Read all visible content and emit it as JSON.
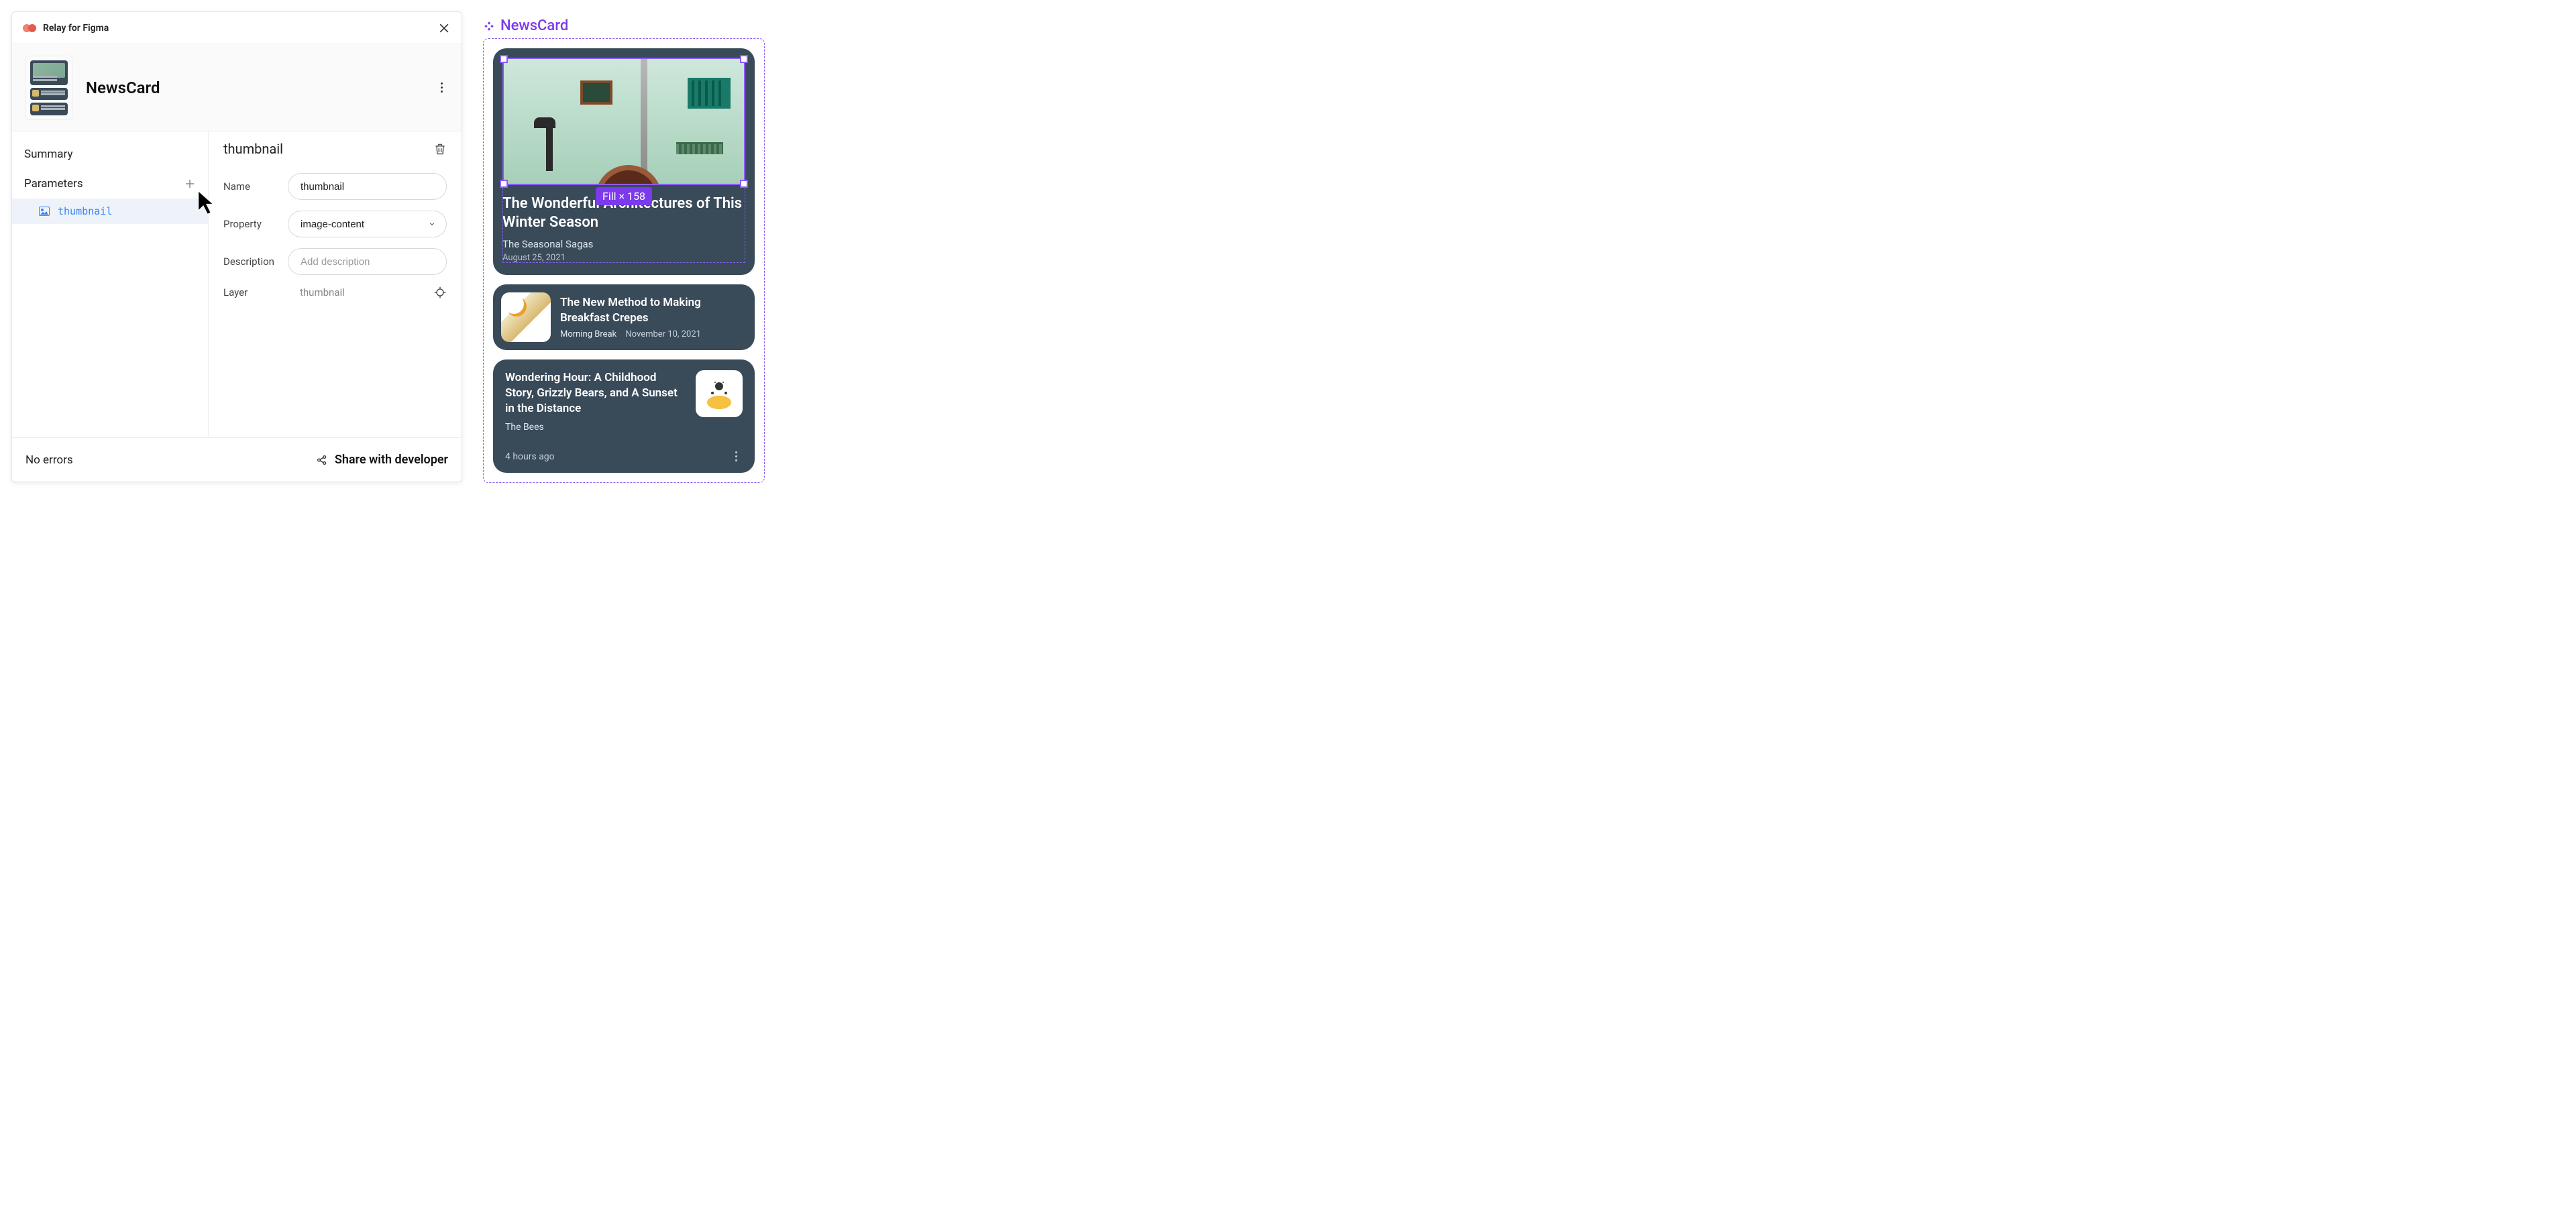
{
  "panel": {
    "pluginTitle": "Relay for Figma",
    "componentName": "NewsCard",
    "sidebar": {
      "summary": "Summary",
      "parameters": "Parameters",
      "paramItems": [
        {
          "label": "thumbnail"
        }
      ]
    },
    "detail": {
      "title": "thumbnail",
      "fields": {
        "nameLabel": "Name",
        "nameValue": "thumbnail",
        "propertyLabel": "Property",
        "propertyValue": "image-content",
        "descriptionLabel": "Description",
        "descriptionPlaceholder": "Add description",
        "layerLabel": "Layer",
        "layerValue": "thumbnail"
      }
    },
    "footer": {
      "status": "No errors",
      "shareLabel": "Share with developer"
    }
  },
  "canvas": {
    "label": "NewsCard",
    "sizeBadge": "Fill × 158",
    "hero": {
      "title": "The Wonderful Architectures of This Winter Season",
      "source": "The Seasonal Sagas",
      "date": "August 25, 2021"
    },
    "audio": {
      "title": "The New Method to Making Breakfast Crepes",
      "source": "Morning Break",
      "date": "November 10, 2021"
    },
    "overflow": {
      "title": "Wondering Hour: A Childhood Story, Grizzly Bears, and A Sunset in the Distance",
      "source": "The Bees",
      "time": "4 hours ago"
    }
  }
}
